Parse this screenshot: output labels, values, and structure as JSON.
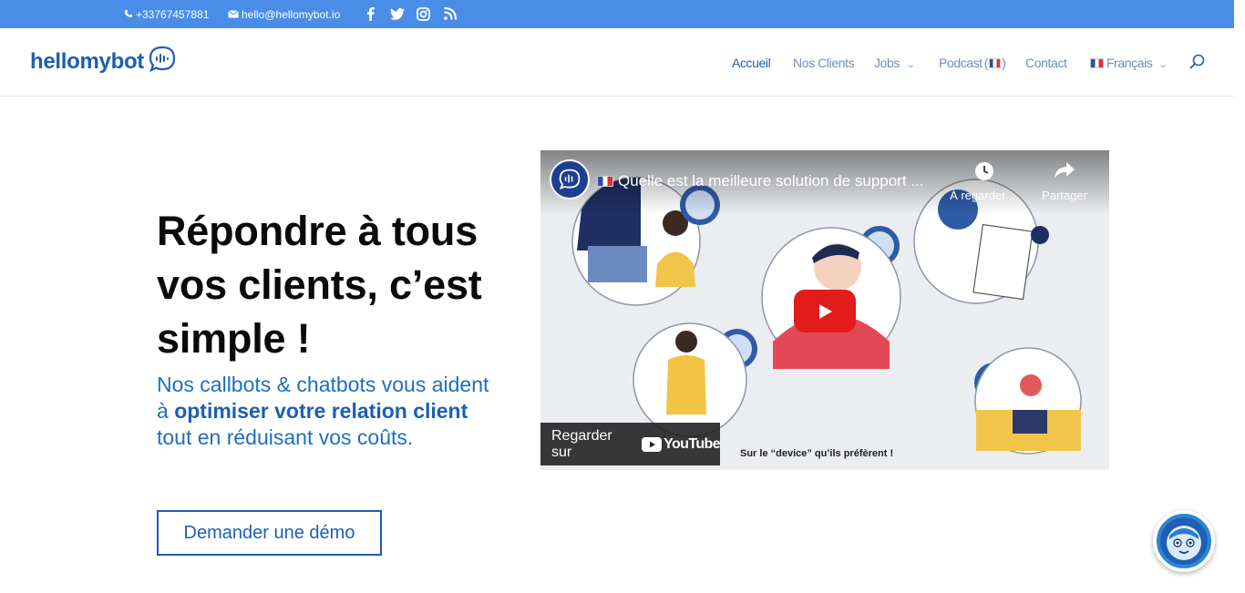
{
  "topbar": {
    "phone": "+33767457881",
    "email": "hello@hellomybot.io",
    "socials": [
      "facebook-icon",
      "twitter-icon",
      "instagram-icon",
      "rss-icon"
    ]
  },
  "header": {
    "logo_text": "hellomybot",
    "nav": [
      {
        "label": "Accueil",
        "active": true
      },
      {
        "label": "Nos Clients"
      },
      {
        "label": "Jobs",
        "dropdown": true
      },
      {
        "label": "Podcast",
        "flag": "fr"
      },
      {
        "label": "Contact"
      },
      {
        "label": "Français",
        "flag": "fr",
        "dropdown": true
      }
    ]
  },
  "hero": {
    "title": "Répondre à tous vos clients, c’est simple !",
    "subtitle_plain1": "Nos callbots & chatbots vous aident à ",
    "subtitle_bold": "optimiser votre relation client",
    "subtitle_plain2": " tout en réduisant vos coûts.",
    "cta": "Demander une démo"
  },
  "video": {
    "title": "Quelle est la meilleure solution de support ...",
    "watch_later": "À regarder ...",
    "share": "Partager",
    "watch_on": "Regarder sur",
    "platform": "YouTube",
    "caption": "Sur le “device” qu’ils préfèrent !"
  },
  "colors": {
    "topbar": "#4a8de8",
    "brand": "#1c5fb0",
    "accent_text": "#1d6ec2",
    "play_red": "#e21b1b"
  }
}
